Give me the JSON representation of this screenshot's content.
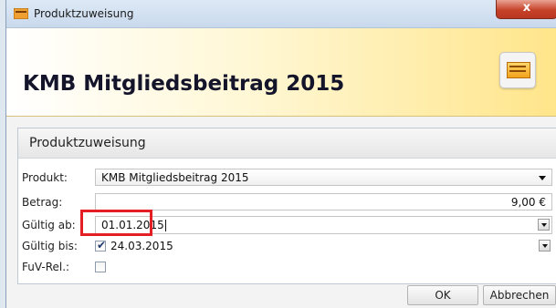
{
  "window": {
    "title": "Produktzuweisung",
    "close_label": "x"
  },
  "banner": {
    "title": "KMB Mitgliedsbeitrag 2015",
    "icon": "package-icon"
  },
  "panel": {
    "title": "Produktzuweisung",
    "produkt": {
      "label": "Produkt:",
      "value": "KMB Mitgliedsbeitrag 2015"
    },
    "betrag": {
      "label": "Betrag:",
      "value": "9,00 €"
    },
    "gueltig_ab": {
      "label": "Gültig ab:",
      "value": "01.01.2015"
    },
    "gueltig_bis": {
      "label": "Gültig bis:",
      "value": "24.03.2015",
      "checked": true
    },
    "fuv_rel": {
      "label": "FuV-Rel.:",
      "checked": false
    }
  },
  "buttons": {
    "ok": "OK",
    "cancel": "Abbrechen"
  },
  "colors": {
    "highlight": "#e41e25",
    "close": "#c7422a"
  }
}
